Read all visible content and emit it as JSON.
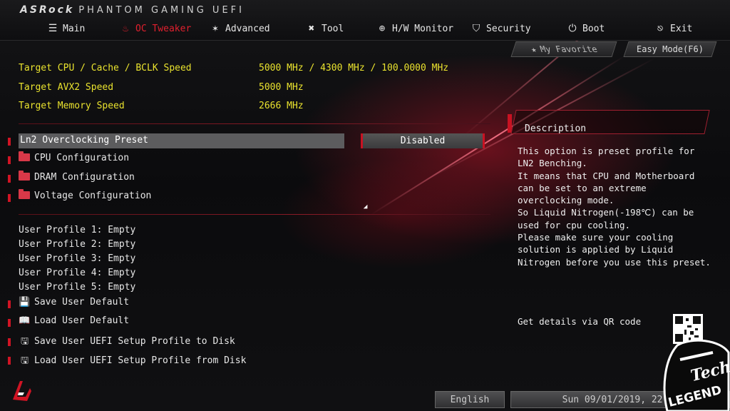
{
  "brand": {
    "logo": "ASRock",
    "subtitle": "PHANTOM GAMING UEFI"
  },
  "nav": [
    {
      "label": "Main",
      "icon": "list-icon"
    },
    {
      "label": "OC Tweaker",
      "icon": "flame-icon",
      "active": true
    },
    {
      "label": "Advanced",
      "icon": "star-icon"
    },
    {
      "label": "Tool",
      "icon": "tools-icon"
    },
    {
      "label": "H/W Monitor",
      "icon": "crosshair-icon"
    },
    {
      "label": "Security",
      "icon": "shield-icon"
    },
    {
      "label": "Boot",
      "icon": "power-icon"
    },
    {
      "label": "Exit",
      "icon": "exit-icon"
    }
  ],
  "quick": {
    "favorite": "My Favorite",
    "easy_mode": "Easy Mode(F6)"
  },
  "targets": [
    {
      "label": "Target CPU / Cache / BCLK Speed",
      "value": "5000 MHz / 4300 MHz / 100.0000 MHz"
    },
    {
      "label": "Target AVX2 Speed",
      "value": "5000 MHz"
    },
    {
      "label": "Target Memory Speed",
      "value": "2666 MHz"
    }
  ],
  "preset": {
    "label": "Ln2 Overclocking Preset",
    "value": "Disabled"
  },
  "submenus": [
    "CPU Configuration",
    "DRAM Configuration",
    "Voltage Configuration"
  ],
  "profiles": [
    "User Profile 1: Empty",
    "User Profile 2: Empty",
    "User Profile 3: Empty",
    "User Profile 4: Empty",
    "User Profile 5: Empty"
  ],
  "actions": [
    "Save User Default",
    "Load User Default",
    "Save User UEFI Setup Profile to Disk",
    "Load User UEFI Setup Profile from Disk"
  ],
  "description": {
    "title": "Description",
    "lines": [
      "This option is preset profile for",
      "LN2 Benching.",
      "It means that CPU and Motherboard",
      "can be set to an extreme",
      "overclocking mode.",
      "So Liquid Nitrogen(-198℃) can be",
      "used for cpu cooling.",
      "Please make sure your cooling",
      "solution is applied by Liquid",
      "Nitrogen before you use this preset."
    ],
    "qr_label": "Get details via QR code"
  },
  "footer": {
    "language": "English",
    "datetime": "Sun 09/01/2019, 22:25"
  },
  "watermark": {
    "line1": "Tech",
    "line2": "LEGEND"
  },
  "colors": {
    "accent": "#d01424",
    "highlight_text": "#e9e22e",
    "selected_row": "#5c5c5e"
  }
}
